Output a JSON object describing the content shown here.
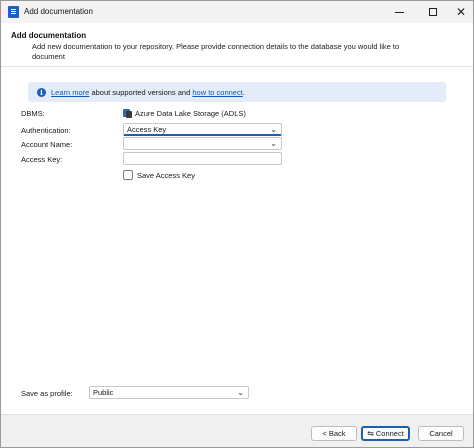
{
  "window": {
    "title": "Add documentation",
    "controls": {
      "minimize": "minimize",
      "maximize": "maximize",
      "close": "✕"
    }
  },
  "header": {
    "title": "Add documentation",
    "description": "Add new documentation to your repository. Please provide connection details to the database you would like to document"
  },
  "info": {
    "link1": "Learn more",
    "middle": " about supported versions and ",
    "link2": "how to connect",
    "end": "."
  },
  "form": {
    "dbms_label": "DBMS:",
    "dbms_value": "Azure Data Lake Storage (ADLS)",
    "auth_label": "Authentication:",
    "auth_value": "Access Key",
    "account_label": "Account Name:",
    "account_value": "",
    "key_label": "Access Key:",
    "key_value": "",
    "save_key_label": "Save Access Key"
  },
  "profile": {
    "label": "Save as profile:",
    "value": "Public"
  },
  "footer": {
    "back": "< Back",
    "connect": "Connect",
    "cancel": "Cancel"
  },
  "colors": {
    "accent": "#1a5fb4",
    "info_bg": "#e3ecf8",
    "link": "#0a5cc2"
  }
}
